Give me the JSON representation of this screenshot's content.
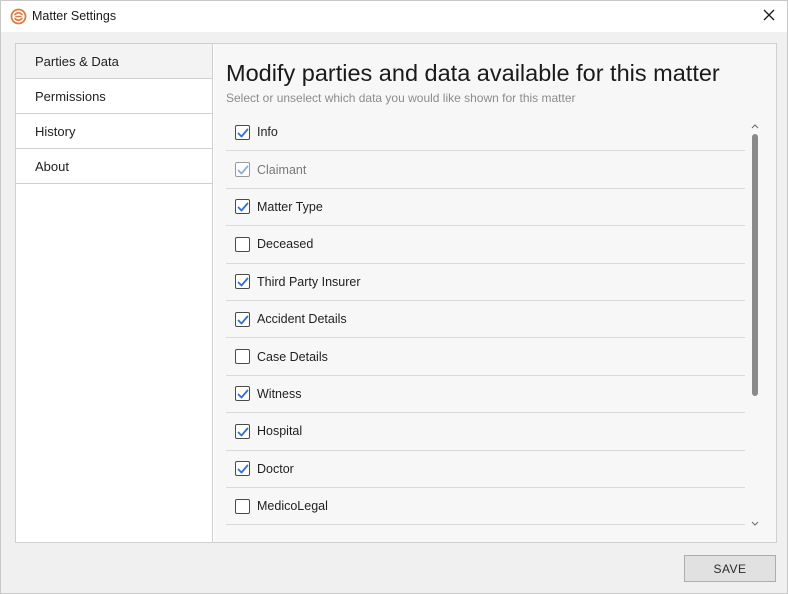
{
  "window": {
    "title": "Matter Settings",
    "accent_color": "#e07a3f",
    "checkbox_color": "#2f6fd6"
  },
  "sidebar": {
    "items": [
      {
        "label": "Parties & Data",
        "active": true
      },
      {
        "label": "Permissions",
        "active": false
      },
      {
        "label": "History",
        "active": false
      },
      {
        "label": "About",
        "active": false
      }
    ]
  },
  "main": {
    "heading": "Modify parties and data available for this matter",
    "subheading": "Select or unselect which data you would like shown for this matter",
    "items": [
      {
        "label": "Info",
        "checked": true,
        "disabled": false
      },
      {
        "label": "Claimant",
        "checked": true,
        "disabled": true
      },
      {
        "label": "Matter Type",
        "checked": true,
        "disabled": false
      },
      {
        "label": "Deceased",
        "checked": false,
        "disabled": false
      },
      {
        "label": "Third Party Insurer",
        "checked": true,
        "disabled": false
      },
      {
        "label": "Accident Details",
        "checked": true,
        "disabled": false
      },
      {
        "label": "Case Details",
        "checked": false,
        "disabled": false
      },
      {
        "label": "Witness",
        "checked": true,
        "disabled": false
      },
      {
        "label": "Hospital",
        "checked": true,
        "disabled": false
      },
      {
        "label": "Doctor",
        "checked": true,
        "disabled": false
      },
      {
        "label": "MedicoLegal",
        "checked": false,
        "disabled": false
      }
    ]
  },
  "footer": {
    "save_label": "SAVE"
  }
}
